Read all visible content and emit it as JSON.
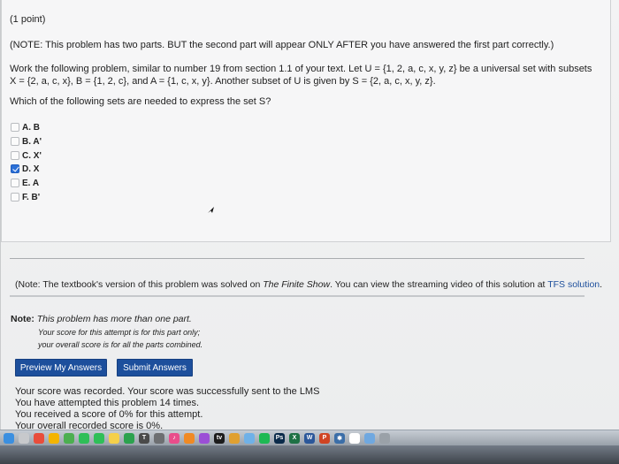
{
  "problem": {
    "points": "(1 point)",
    "note": "(NOTE: This problem has two parts. BUT the second part will appear ONLY AFTER you have answered the first part correctly.)",
    "intro_line1": "Work the following problem, similar to number 19 from section 1.1 of your text. Let U = {1, 2, a, c, x, y, z} be a universal set with subsets",
    "intro_line2": "X = {2, a, c, x}, B = {1, 2, c}, and A = {1, c, x, y}. Another subset of U is given by S = {2, a, c, x, y, z}.",
    "question": "Which of the following sets are needed to express the set S?",
    "options": [
      {
        "label": "A. B",
        "checked": false
      },
      {
        "label": "B. A'",
        "checked": false
      },
      {
        "label": "C. X'",
        "checked": false
      },
      {
        "label": "D. X",
        "checked": true
      },
      {
        "label": "E. A",
        "checked": false
      },
      {
        "label": "F. B'",
        "checked": false
      }
    ]
  },
  "textbook_note": {
    "prefix": "(Note: The textbook's version of this problem was solved on ",
    "show": "The Finite Show",
    "middle": ". You can view the streaming video of this solution at ",
    "link": "TFS solution",
    "suffix": "."
  },
  "multipart": {
    "note_label": "Note:",
    "note_text": " This problem has more than one part.",
    "score_line1": "Your score for this attempt is for this part only;",
    "score_line2": "your overall score is for all the parts combined."
  },
  "buttons": {
    "preview": "Preview My Answers",
    "submit": "Submit Answers"
  },
  "status": {
    "line1": "Your score was recorded. Your score was successfully sent to the LMS",
    "line2": "You have attempted this problem 14 times.",
    "line3": "You received a score of 0% for this attempt.",
    "line4": "Your overall recorded score is 0%."
  },
  "dock": {
    "icons": [
      {
        "name": "finder-icon",
        "color": "#3b8fe0",
        "glyph": ""
      },
      {
        "name": "launchpad-icon",
        "color": "#c7c9cc",
        "glyph": ""
      },
      {
        "name": "chrome-icon",
        "color": "#e94d3b",
        "glyph": ""
      },
      {
        "name": "photos-icon",
        "color": "#f4b400",
        "glyph": ""
      },
      {
        "name": "maps-icon",
        "color": "#4caf50",
        "glyph": ""
      },
      {
        "name": "messages-icon",
        "color": "#2fbf58",
        "glyph": ""
      },
      {
        "name": "facetime-icon",
        "color": "#2fbf58",
        "glyph": ""
      },
      {
        "name": "notes-icon",
        "color": "#f5d04a",
        "glyph": ""
      },
      {
        "name": "numbers-icon",
        "color": "#2ca24e",
        "glyph": ""
      },
      {
        "name": "fonts-icon",
        "color": "#4a4a4a",
        "glyph": "T"
      },
      {
        "name": "settings-icon",
        "color": "#6d6f72",
        "glyph": ""
      },
      {
        "name": "itunes-icon",
        "color": "#e94d8b",
        "glyph": "♪"
      },
      {
        "name": "ibooks-icon",
        "color": "#f08a24",
        "glyph": ""
      },
      {
        "name": "podcasts-icon",
        "color": "#9b4fd6",
        "glyph": ""
      },
      {
        "name": "tv-icon",
        "color": "#1c1c1c",
        "glyph": "tv"
      },
      {
        "name": "app-icon",
        "color": "#e0a030",
        "glyph": ""
      },
      {
        "name": "maps2-icon",
        "color": "#6fb1e8",
        "glyph": ""
      },
      {
        "name": "spotify-icon",
        "color": "#1db954",
        "glyph": ""
      },
      {
        "name": "photoshop-icon",
        "color": "#0a2a4a",
        "glyph": "Ps"
      },
      {
        "name": "excel-icon",
        "color": "#1e7145",
        "glyph": "X"
      },
      {
        "name": "word-icon",
        "color": "#2b579a",
        "glyph": "W"
      },
      {
        "name": "powerpoint-icon",
        "color": "#d04423",
        "glyph": "P"
      },
      {
        "name": "bluetooth-icon",
        "color": "#3b6ea8",
        "glyph": "✱"
      },
      {
        "name": "calendar-icon",
        "color": "#ffffff",
        "glyph": ""
      },
      {
        "name": "folder-icon",
        "color": "#6fa8e0",
        "glyph": ""
      },
      {
        "name": "trash-icon",
        "color": "#9aa1a8",
        "glyph": ""
      }
    ]
  }
}
